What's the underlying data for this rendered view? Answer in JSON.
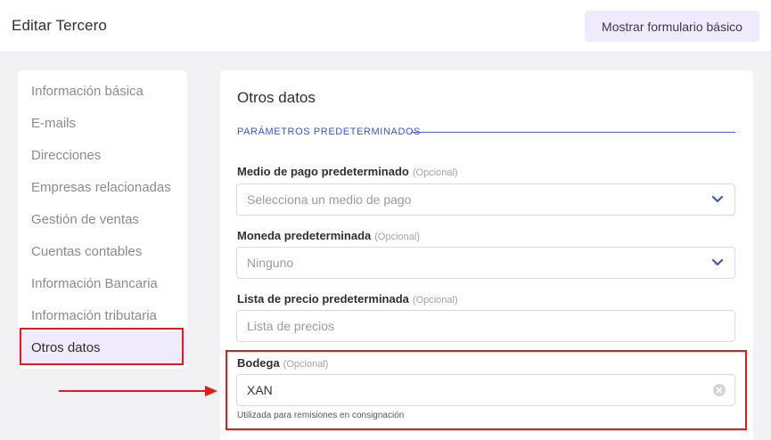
{
  "header": {
    "title": "Editar Tercero",
    "basic_form_button": "Mostrar formulario básico"
  },
  "sidebar": {
    "items": [
      {
        "label": "Información básica"
      },
      {
        "label": "E-mails"
      },
      {
        "label": "Direcciones"
      },
      {
        "label": "Empresas relacionadas"
      },
      {
        "label": "Gestión de ventas"
      },
      {
        "label": "Cuentas contables"
      },
      {
        "label": "Información Bancaria"
      },
      {
        "label": "Información tributaria"
      },
      {
        "label": "Otros datos"
      }
    ],
    "active": "Otros datos"
  },
  "main": {
    "title": "Otros datos",
    "section": "PARÁMETROS PREDETERMINADOS",
    "optional_tag": "(Opcional)",
    "fields": {
      "payment": {
        "label": "Medio de pago predeterminado",
        "placeholder": "Selecciona un medio de pago",
        "icon": "chevron-down-icon"
      },
      "currency": {
        "label": "Moneda predeterminada",
        "value": "Ninguno",
        "icon": "chevron-down-icon"
      },
      "price_list": {
        "label": "Lista de precio predeterminada",
        "placeholder": "Lista de precios"
      },
      "warehouse": {
        "label": "Bodega",
        "value": "XAN",
        "helper": "Utilizada para remisiones en consignación",
        "icon": "clear-icon"
      }
    }
  },
  "colors": {
    "accent": "#3d54d6",
    "active_bg": "#efeafc",
    "annotation": "#e31b1b"
  }
}
